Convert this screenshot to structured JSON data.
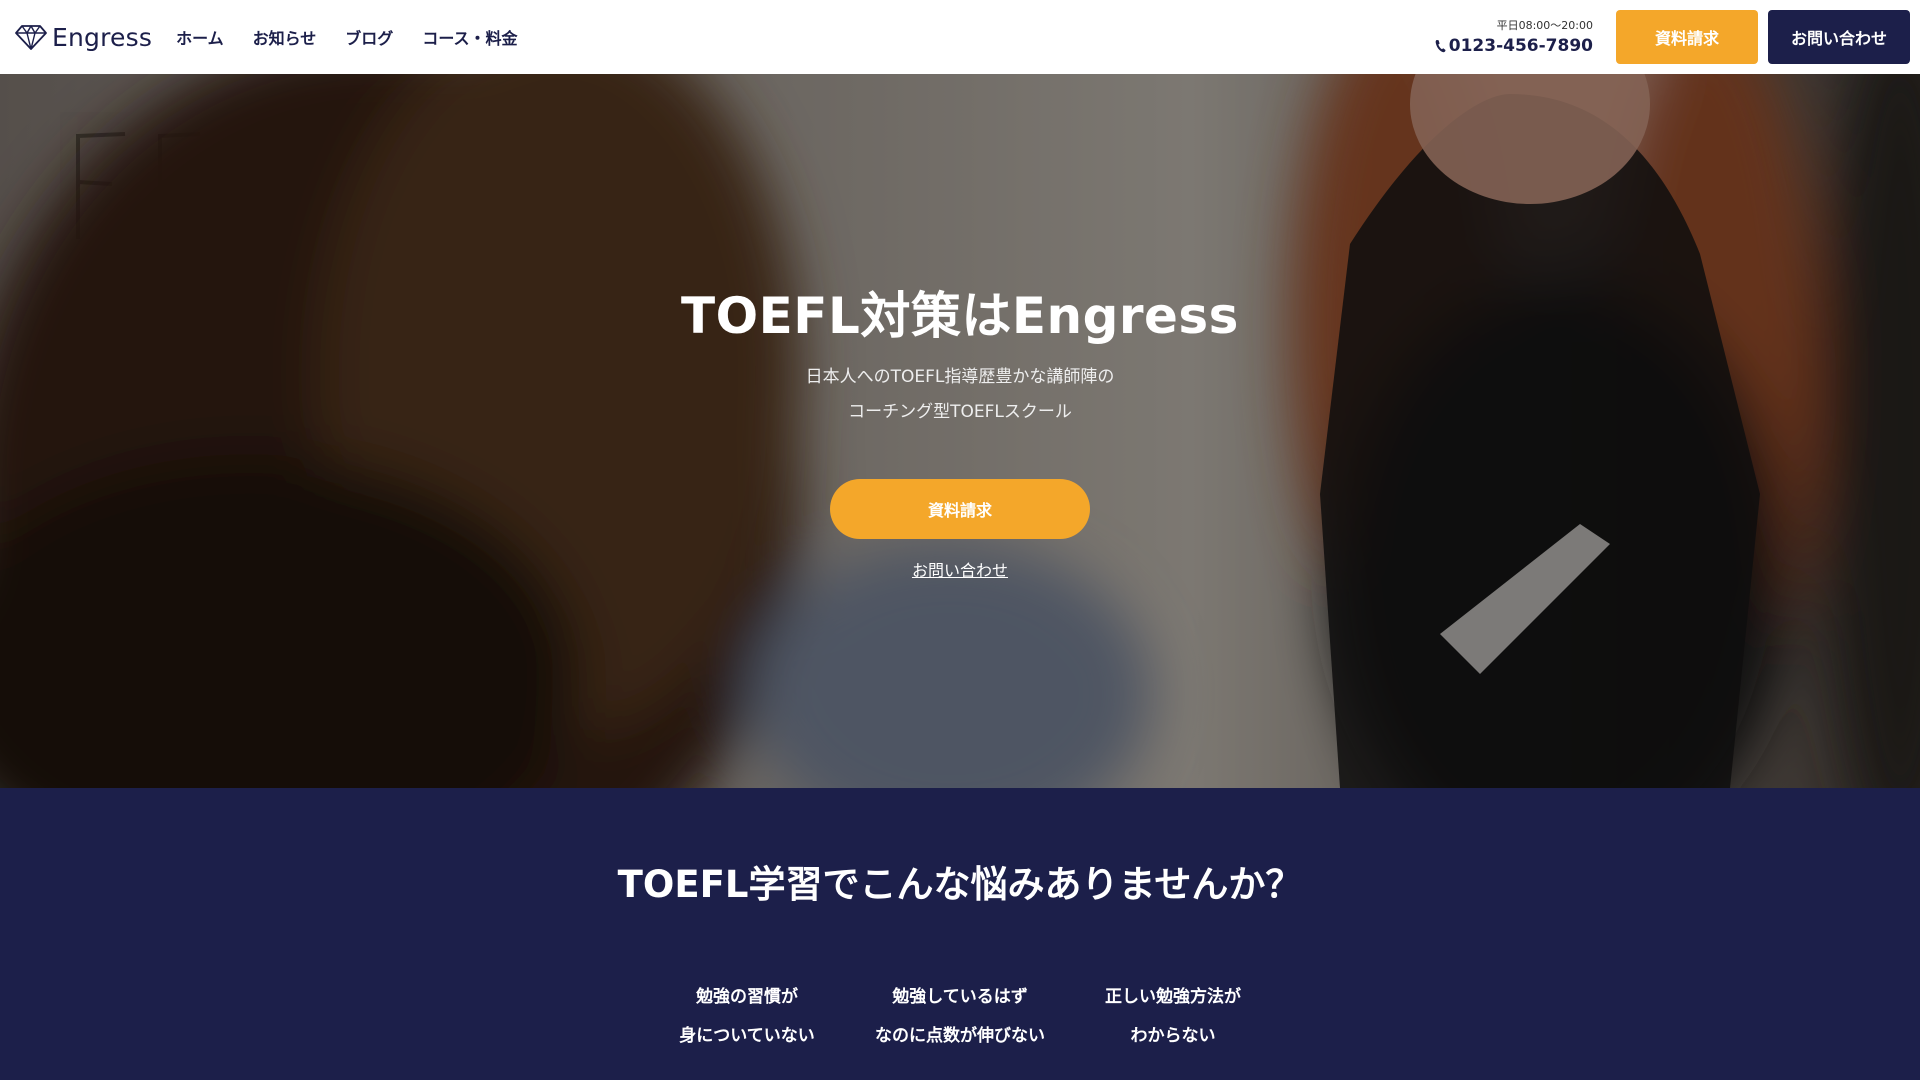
{
  "header": {
    "logo_text": "Engress",
    "nav": [
      "ホーム",
      "お知らせ",
      "ブログ",
      "コース・料金"
    ],
    "hours": "平日08:00〜20:00",
    "phone": "0123-456-7890",
    "request_label": "資料請求",
    "contact_label": "お問い合わせ"
  },
  "hero": {
    "title": "TOEFL対策はEngress",
    "sub_line1": "日本人へのTOEFL指導歴豊かな講師陣の",
    "sub_line2": "コーチング型TOEFLスクール",
    "cta_label": "資料請求",
    "link_label": "お問い合わせ"
  },
  "problems": {
    "title": "TOEFL学習でこんな悩みありませんか？",
    "items": [
      {
        "line1": "勉強の習慣が",
        "line2": "身についていない"
      },
      {
        "line1": "勉強しているはず",
        "line2": "なのに点数が伸びない"
      },
      {
        "line1": "正しい勉強方法が",
        "line2": "わからない"
      }
    ]
  },
  "colors": {
    "accent_orange": "#f4a72a",
    "brand_navy": "#1c1f4a",
    "header_bg": "#ffffff"
  },
  "icons": {
    "logo": "diamond-icon",
    "phone": "phone-icon"
  }
}
